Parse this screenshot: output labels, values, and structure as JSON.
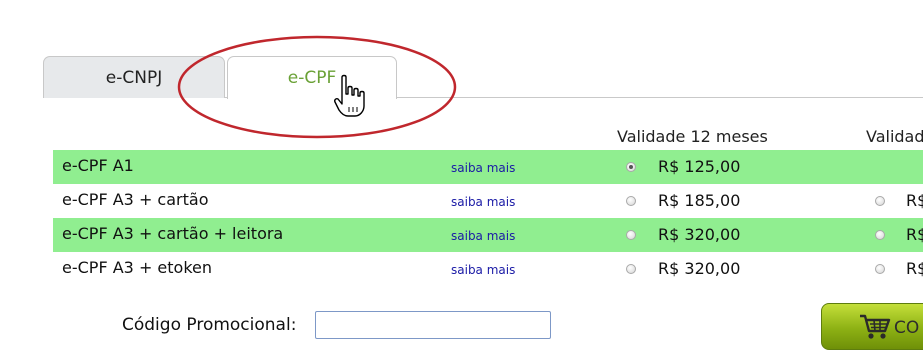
{
  "tabs": [
    {
      "label": "e-CNPJ",
      "active": false
    },
    {
      "label": "e-CPF",
      "active": true
    }
  ],
  "columns": {
    "validity_1": "Validade 12 meses",
    "validity_2": "Validad"
  },
  "rows": [
    {
      "name": "e-CPF A1",
      "saiba": "saiba mais",
      "price": "R$ 125,00",
      "price2": "",
      "selected": true,
      "has_second": false,
      "highlight": true
    },
    {
      "name": "e-CPF A3 + cartão",
      "saiba": "saiba mais",
      "price": "R$ 185,00",
      "price2": "R$",
      "selected": false,
      "has_second": true,
      "highlight": false
    },
    {
      "name": "e-CPF A3 + cartão + leitora",
      "saiba": "saiba mais",
      "price": "R$ 320,00",
      "price2": "R$",
      "selected": false,
      "has_second": true,
      "highlight": true
    },
    {
      "name": "e-CPF A3 + etoken",
      "saiba": "saiba mais",
      "price": "R$ 320,00",
      "price2": "R$",
      "selected": false,
      "has_second": true,
      "highlight": false
    }
  ],
  "promo": {
    "label": "Código Promocional:",
    "value": "",
    "placeholder": ""
  },
  "buy_button": {
    "label": "CO"
  },
  "colors": {
    "highlight_row": "#90ee90",
    "active_tab_text": "#6aa136",
    "annotation_oval": "#c0272d",
    "link": "#1a1aa6"
  },
  "icons": [
    "cart-icon",
    "hand-pointer-icon",
    "radio-icon"
  ]
}
